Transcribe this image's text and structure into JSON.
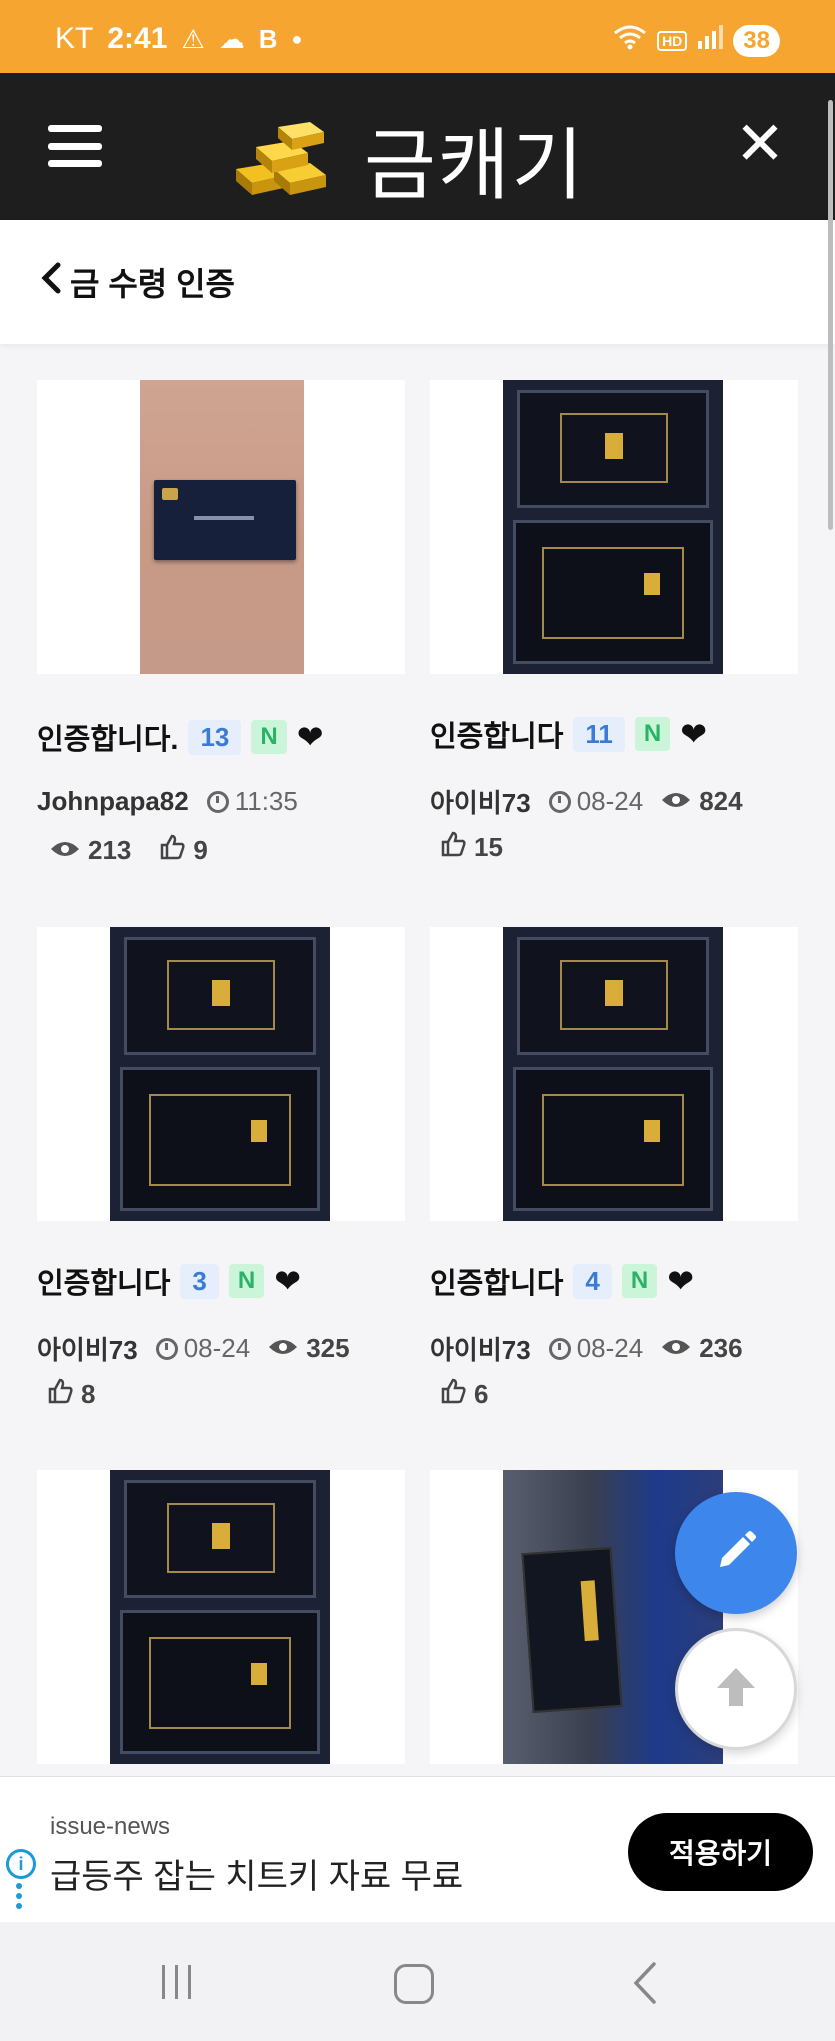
{
  "status_bar": {
    "carrier": "KT",
    "time": "2:41",
    "battery": "38"
  },
  "app": {
    "name": "금캐기",
    "brand_color": "#f7a531"
  },
  "subheader": {
    "title": "금 수령 인증"
  },
  "posts": [
    {
      "title": "인증합니다.",
      "comments": "13",
      "new_badge": "N",
      "author": "Johnpapa82",
      "time": "11:35",
      "views": "213",
      "likes": "9"
    },
    {
      "title": "인증합니다",
      "comments": "11",
      "new_badge": "N",
      "author": "아이비73",
      "time": "08-24",
      "views": "824",
      "likes": "15"
    },
    {
      "title": "인증합니다",
      "comments": "3",
      "new_badge": "N",
      "author": "아이비73",
      "time": "08-24",
      "views": "325",
      "likes": "8"
    },
    {
      "title": "인증합니다",
      "comments": "4",
      "new_badge": "N",
      "author": "아이비73",
      "time": "08-24",
      "views": "236",
      "likes": "6"
    }
  ],
  "ad": {
    "source": "issue-news",
    "title": "급등주 잡는 치트키 자료 무료",
    "cta": "적용하기"
  },
  "icons": [
    "hamburger-menu-icon",
    "gold-bars-logo-icon",
    "close-icon",
    "chevron-left-icon",
    "clock-icon",
    "eye-icon",
    "thumbs-up-icon",
    "heart-icon",
    "pencil-icon",
    "arrow-up-icon",
    "info-icon"
  ]
}
